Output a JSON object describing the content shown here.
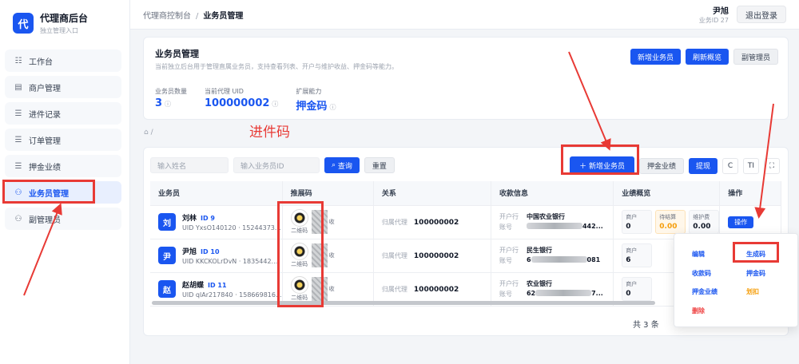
{
  "brand": {
    "logo_char": "代",
    "title": "代理商后台",
    "subtitle": "独立管理入口"
  },
  "sidebar": {
    "items": [
      {
        "icon": "grid-icon",
        "glyph": "☷",
        "label": "工作台"
      },
      {
        "icon": "merchant-icon",
        "glyph": "▤",
        "label": "商户管理"
      },
      {
        "icon": "list-icon",
        "glyph": "☰",
        "label": "进件记录"
      },
      {
        "icon": "list-icon",
        "glyph": "☰",
        "label": "订单管理"
      },
      {
        "icon": "list-icon",
        "glyph": "☰",
        "label": "押金业绩"
      },
      {
        "icon": "user-icon",
        "glyph": "⚇",
        "label": "业务员管理",
        "active": true
      },
      {
        "icon": "user-icon",
        "glyph": "⚇",
        "label": "副管理员"
      }
    ]
  },
  "topbar": {
    "breadcrumb_root": "代理商控制台",
    "breadcrumb_sep": "/",
    "breadcrumb_current": "业务员管理",
    "user_name": "尹旭",
    "user_id": "业务ID 27",
    "logout_label": "退出登录"
  },
  "header": {
    "title": "业务员管理",
    "desc": "当前独立后台用于管理直属业务员，支持查看列表、开户与维护收益、押金码等能力。",
    "btn_new": "新增业务员",
    "btn_refresh": "刷新概览",
    "btn_sub": "副管理员",
    "stats": [
      {
        "label": "业务员数量",
        "value": "3"
      },
      {
        "label": "当前代理 UID",
        "value": "100000002"
      },
      {
        "label": "扩展能力",
        "value": "押金码"
      }
    ]
  },
  "home": {
    "sep": "/"
  },
  "filters": {
    "name_placeholder": "输入姓名",
    "uid_placeholder": "输入业务员ID",
    "search_label": "查询",
    "reset_label": "重置"
  },
  "toolbar": {
    "new_label": "新增业务员",
    "deposit_label": "押金业绩",
    "withdraw_label": "提现",
    "refresh_glyph": "C",
    "density_glyph": "TI",
    "fullscreen_glyph": "⛶"
  },
  "table": {
    "headers": [
      "业务员",
      "推展码",
      "关系",
      "收款信息",
      "业绩概览",
      "操作"
    ],
    "rows": [
      {
        "avatar": "刘",
        "name": "刘林",
        "id_tag": "ID 9",
        "uid": "UID YxsO140120 · 15244373...",
        "qr_caption": "二维码",
        "qr_extra": "收",
        "rel_label": "归属代理",
        "rel_value": "100000002",
        "bank_label": "开户行",
        "bank": "中国农业银行",
        "acct_label": "账号",
        "acct_tail": "442...",
        "perf": [
          {
            "label": "商户",
            "value": "0"
          },
          {
            "label": "待结算",
            "value": "0.00"
          },
          {
            "label": "维护费",
            "value": "0.00"
          }
        ],
        "op_label": "操作"
      },
      {
        "avatar": "尹",
        "name": "尹旭",
        "id_tag": "ID 10",
        "uid": "UID KKCKOLrDvN · 1835442...",
        "qr_caption": "二维码",
        "qr_extra": "收",
        "rel_label": "归属代理",
        "rel_value": "100000002",
        "bank_label": "开户行",
        "bank": "民生银行",
        "acct_label": "账号",
        "acct_head": "6",
        "acct_tail": "081",
        "perf": [
          {
            "label": "商户",
            "value": "6"
          }
        ]
      },
      {
        "avatar": "赵",
        "name": "赵胡蝶",
        "id_tag": "ID 11",
        "uid": "UID qlAr217840 · 158669816...",
        "qr_caption": "二维码",
        "qr_extra": "收",
        "rel_label": "归属代理",
        "rel_value": "100000002",
        "bank_label": "开户行",
        "bank": "农业银行",
        "acct_label": "账号",
        "acct_head": "62",
        "acct_tail": "7...",
        "perf": [
          {
            "label": "商户",
            "value": "0"
          }
        ]
      }
    ],
    "total": "共 3 条"
  },
  "menu": {
    "items": [
      {
        "label": "编辑",
        "color": "#1a56f0"
      },
      {
        "label": "生成码",
        "color": "#1a56f0"
      },
      {
        "label": "收款码",
        "color": "#1a56f0"
      },
      {
        "label": "押金码",
        "color": "#1a56f0"
      },
      {
        "label": "押金业绩",
        "color": "#1a56f0"
      },
      {
        "label": "划扣",
        "color": "#f59e0b"
      },
      {
        "label": "删除",
        "color": "#ef4444"
      }
    ]
  },
  "annotation": {
    "text": "进件码",
    "color": "#e83a35"
  },
  "colors": {
    "primary": "#1a56f0",
    "warning": "#f59e0b",
    "danger": "#ef4444",
    "annotation": "#e83a35"
  }
}
